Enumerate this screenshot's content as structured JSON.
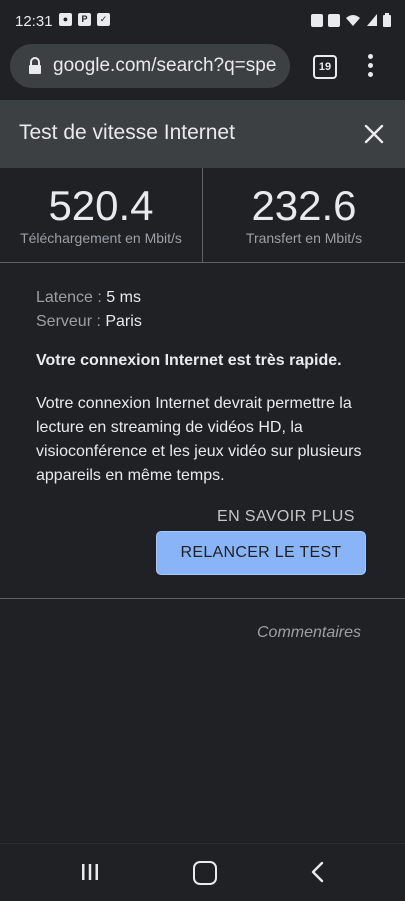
{
  "status_bar": {
    "time": "12:31",
    "left_icons": [
      "notification-icon",
      "paypal-icon",
      "check-icon"
    ],
    "right_icons": [
      "nfc-icon",
      "alarm-icon",
      "wifi-icon",
      "signal-icon",
      "battery-icon"
    ]
  },
  "browser": {
    "url": "google.com/search?q=spe",
    "tab_count": "19"
  },
  "speedtest": {
    "title": "Test de vitesse Internet",
    "download_value": "520.4",
    "download_label": "Téléchargement en Mbit/s",
    "upload_value": "232.6",
    "upload_label": "Transfert en Mbit/s",
    "latency_label": "Latence : ",
    "latency_value": "5 ms",
    "server_label": "Serveur : ",
    "server_value": "Paris",
    "headline": "Votre connexion Internet est très rapide.",
    "description": "Votre connexion Internet devrait permettre la lecture en streaming de vidéos HD, la visioconférence et les jeux vidéo sur plusieurs appareils en même temps.",
    "learn_more": "EN SAVOIR PLUS",
    "retry_button": "RELANCER LE TEST",
    "feedback": "Commentaires"
  },
  "colors": {
    "background": "#202124",
    "panel": "#3c4043",
    "accent": "#8ab4f8"
  }
}
